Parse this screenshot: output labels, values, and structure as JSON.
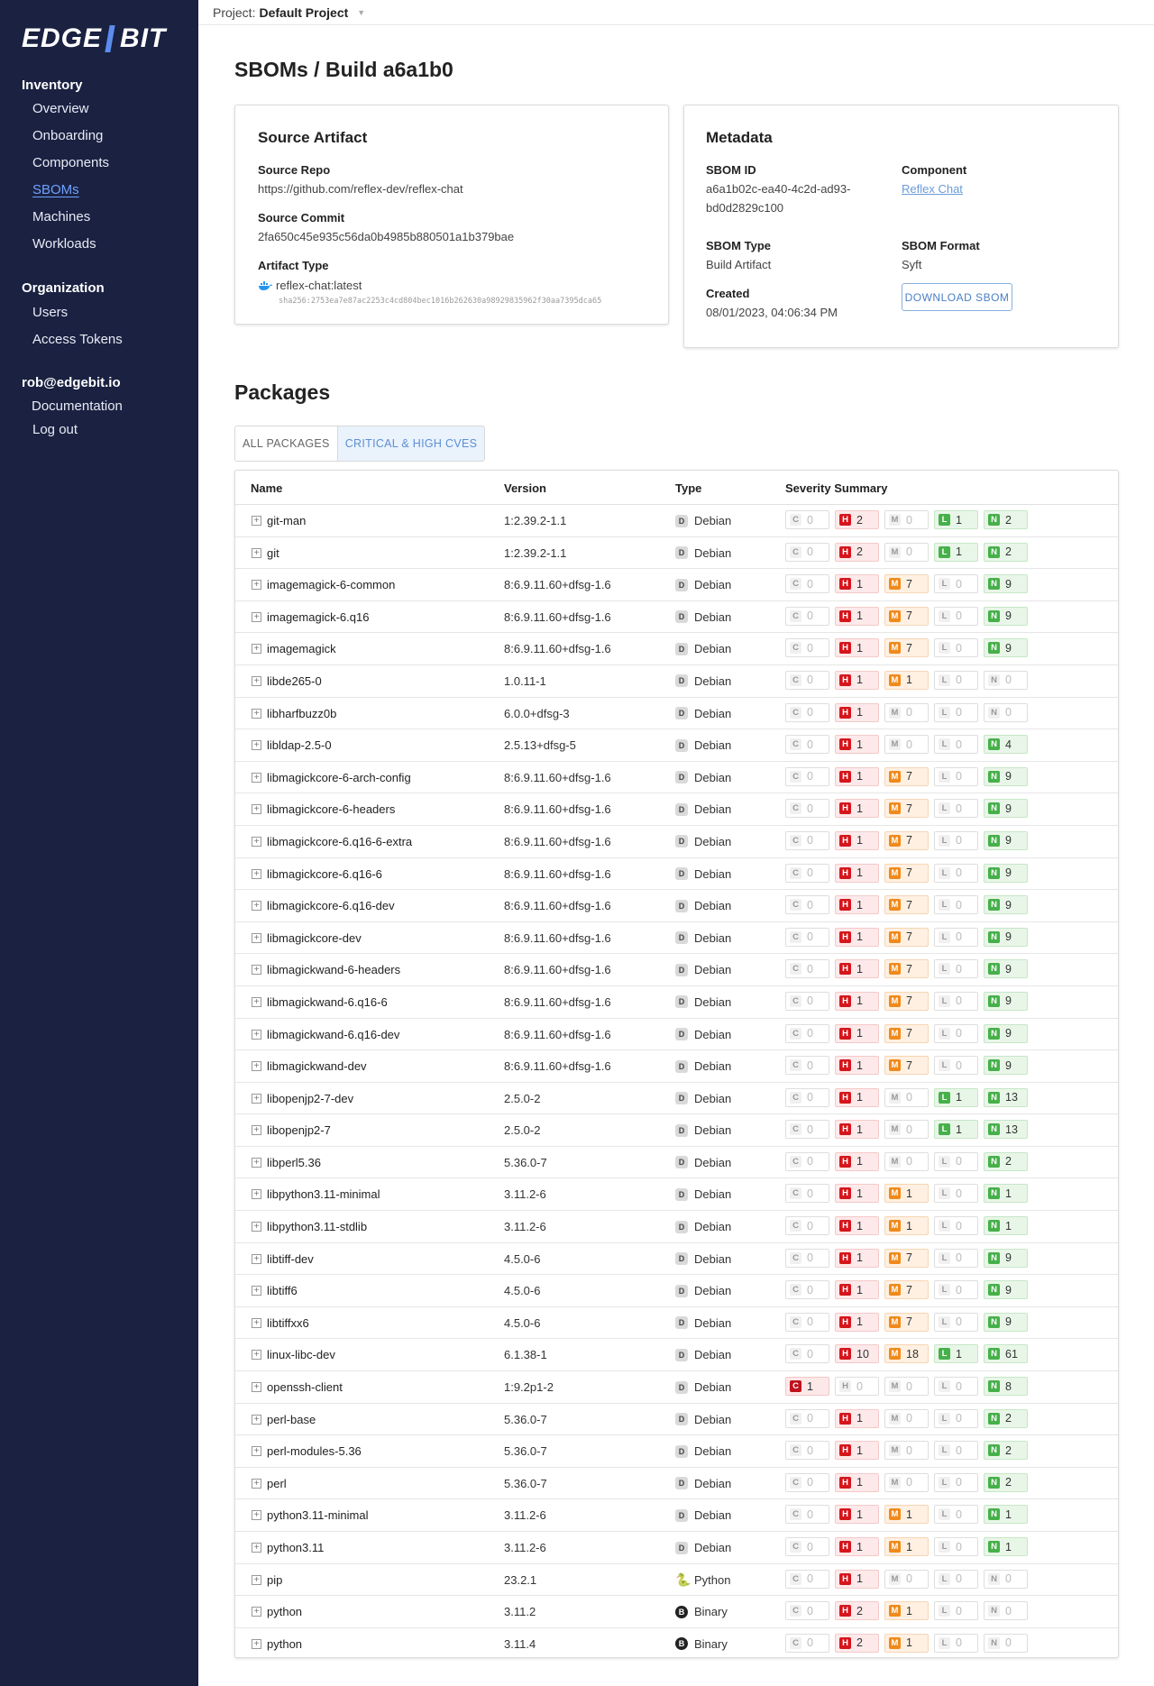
{
  "sidebar": {
    "logo_left": "EDGE",
    "logo_right": "BIT",
    "inventory_heading": "Inventory",
    "inventory_items": [
      "Overview",
      "Onboarding",
      "Components",
      "SBOMs",
      "Machines",
      "Workloads"
    ],
    "active_item": "SBOMs",
    "organization_heading": "Organization",
    "organization_items": [
      "Users",
      "Access Tokens"
    ],
    "user_email": "rob@edgebit.io",
    "user_items": [
      "Documentation",
      "Log out"
    ]
  },
  "topbar": {
    "project_label": "Project:",
    "project_value": "Default Project"
  },
  "page_title": "SBOMs / Build a6a1b0",
  "source_artifact": {
    "title": "Source Artifact",
    "repo_label": "Source Repo",
    "repo_value": "https://github.com/reflex-dev/reflex-chat",
    "commit_label": "Source Commit",
    "commit_value": "2fa650c45e935c56da0b4985b880501a1b379bae",
    "artifact_type_label": "Artifact Type",
    "artifact_image": "reflex-chat:latest",
    "artifact_digest": "sha256:2753ea7e87ac2253c4cd804bec1016b262630a98929835962f30aa7395dca65"
  },
  "metadata": {
    "title": "Metadata",
    "sbom_id_label": "SBOM ID",
    "sbom_id_line1": "a6a1b02c-ea40-4c2d-ad93-",
    "sbom_id_line2": "bd0d2829c100",
    "component_label": "Component",
    "component_value": "Reflex Chat",
    "sbom_type_label": "SBOM Type",
    "sbom_type_value": "Build Artifact",
    "sbom_format_label": "SBOM Format",
    "sbom_format_value": "Syft",
    "created_label": "Created",
    "created_value": "08/01/2023, 04:06:34 PM",
    "download_button": "DOWNLOAD SBOM"
  },
  "packages": {
    "title": "Packages",
    "tabs": [
      "ALL PACKAGES",
      "CRITICAL & HIGH CVES"
    ],
    "active_tab": "CRITICAL & HIGH CVES",
    "columns": [
      "Name",
      "Version",
      "Type",
      "Severity Summary"
    ],
    "severity_letters": [
      "C",
      "H",
      "M",
      "L",
      "N"
    ],
    "rows": [
      {
        "name": "git-man",
        "version": "1:2.39.2-1.1",
        "type": "Debian",
        "sev": [
          0,
          2,
          0,
          1,
          2
        ]
      },
      {
        "name": "git",
        "version": "1:2.39.2-1.1",
        "type": "Debian",
        "sev": [
          0,
          2,
          0,
          1,
          2
        ]
      },
      {
        "name": "imagemagick-6-common",
        "version": "8:6.9.11.60+dfsg-1.6",
        "type": "Debian",
        "sev": [
          0,
          1,
          7,
          0,
          9
        ]
      },
      {
        "name": "imagemagick-6.q16",
        "version": "8:6.9.11.60+dfsg-1.6",
        "type": "Debian",
        "sev": [
          0,
          1,
          7,
          0,
          9
        ]
      },
      {
        "name": "imagemagick",
        "version": "8:6.9.11.60+dfsg-1.6",
        "type": "Debian",
        "sev": [
          0,
          1,
          7,
          0,
          9
        ]
      },
      {
        "name": "libde265-0",
        "version": "1.0.11-1",
        "type": "Debian",
        "sev": [
          0,
          1,
          1,
          0,
          0
        ]
      },
      {
        "name": "libharfbuzz0b",
        "version": "6.0.0+dfsg-3",
        "type": "Debian",
        "sev": [
          0,
          1,
          0,
          0,
          0
        ]
      },
      {
        "name": "libldap-2.5-0",
        "version": "2.5.13+dfsg-5",
        "type": "Debian",
        "sev": [
          0,
          1,
          0,
          0,
          4
        ]
      },
      {
        "name": "libmagickcore-6-arch-config",
        "version": "8:6.9.11.60+dfsg-1.6",
        "type": "Debian",
        "sev": [
          0,
          1,
          7,
          0,
          9
        ]
      },
      {
        "name": "libmagickcore-6-headers",
        "version": "8:6.9.11.60+dfsg-1.6",
        "type": "Debian",
        "sev": [
          0,
          1,
          7,
          0,
          9
        ]
      },
      {
        "name": "libmagickcore-6.q16-6-extra",
        "version": "8:6.9.11.60+dfsg-1.6",
        "type": "Debian",
        "sev": [
          0,
          1,
          7,
          0,
          9
        ]
      },
      {
        "name": "libmagickcore-6.q16-6",
        "version": "8:6.9.11.60+dfsg-1.6",
        "type": "Debian",
        "sev": [
          0,
          1,
          7,
          0,
          9
        ]
      },
      {
        "name": "libmagickcore-6.q16-dev",
        "version": "8:6.9.11.60+dfsg-1.6",
        "type": "Debian",
        "sev": [
          0,
          1,
          7,
          0,
          9
        ]
      },
      {
        "name": "libmagickcore-dev",
        "version": "8:6.9.11.60+dfsg-1.6",
        "type": "Debian",
        "sev": [
          0,
          1,
          7,
          0,
          9
        ]
      },
      {
        "name": "libmagickwand-6-headers",
        "version": "8:6.9.11.60+dfsg-1.6",
        "type": "Debian",
        "sev": [
          0,
          1,
          7,
          0,
          9
        ]
      },
      {
        "name": "libmagickwand-6.q16-6",
        "version": "8:6.9.11.60+dfsg-1.6",
        "type": "Debian",
        "sev": [
          0,
          1,
          7,
          0,
          9
        ]
      },
      {
        "name": "libmagickwand-6.q16-dev",
        "version": "8:6.9.11.60+dfsg-1.6",
        "type": "Debian",
        "sev": [
          0,
          1,
          7,
          0,
          9
        ]
      },
      {
        "name": "libmagickwand-dev",
        "version": "8:6.9.11.60+dfsg-1.6",
        "type": "Debian",
        "sev": [
          0,
          1,
          7,
          0,
          9
        ]
      },
      {
        "name": "libopenjp2-7-dev",
        "version": "2.5.0-2",
        "type": "Debian",
        "sev": [
          0,
          1,
          0,
          1,
          13
        ]
      },
      {
        "name": "libopenjp2-7",
        "version": "2.5.0-2",
        "type": "Debian",
        "sev": [
          0,
          1,
          0,
          1,
          13
        ]
      },
      {
        "name": "libperl5.36",
        "version": "5.36.0-7",
        "type": "Debian",
        "sev": [
          0,
          1,
          0,
          0,
          2
        ]
      },
      {
        "name": "libpython3.11-minimal",
        "version": "3.11.2-6",
        "type": "Debian",
        "sev": [
          0,
          1,
          1,
          0,
          1
        ]
      },
      {
        "name": "libpython3.11-stdlib",
        "version": "3.11.2-6",
        "type": "Debian",
        "sev": [
          0,
          1,
          1,
          0,
          1
        ]
      },
      {
        "name": "libtiff-dev",
        "version": "4.5.0-6",
        "type": "Debian",
        "sev": [
          0,
          1,
          7,
          0,
          9
        ]
      },
      {
        "name": "libtiff6",
        "version": "4.5.0-6",
        "type": "Debian",
        "sev": [
          0,
          1,
          7,
          0,
          9
        ]
      },
      {
        "name": "libtiffxx6",
        "version": "4.5.0-6",
        "type": "Debian",
        "sev": [
          0,
          1,
          7,
          0,
          9
        ]
      },
      {
        "name": "linux-libc-dev",
        "version": "6.1.38-1",
        "type": "Debian",
        "sev": [
          0,
          10,
          18,
          1,
          61
        ]
      },
      {
        "name": "openssh-client",
        "version": "1:9.2p1-2",
        "type": "Debian",
        "sev": [
          1,
          0,
          0,
          0,
          8
        ]
      },
      {
        "name": "perl-base",
        "version": "5.36.0-7",
        "type": "Debian",
        "sev": [
          0,
          1,
          0,
          0,
          2
        ]
      },
      {
        "name": "perl-modules-5.36",
        "version": "5.36.0-7",
        "type": "Debian",
        "sev": [
          0,
          1,
          0,
          0,
          2
        ]
      },
      {
        "name": "perl",
        "version": "5.36.0-7",
        "type": "Debian",
        "sev": [
          0,
          1,
          0,
          0,
          2
        ]
      },
      {
        "name": "python3.11-minimal",
        "version": "3.11.2-6",
        "type": "Debian",
        "sev": [
          0,
          1,
          1,
          0,
          1
        ]
      },
      {
        "name": "python3.11",
        "version": "3.11.2-6",
        "type": "Debian",
        "sev": [
          0,
          1,
          1,
          0,
          1
        ]
      },
      {
        "name": "pip",
        "version": "23.2.1",
        "type": "Python",
        "sev": [
          0,
          1,
          0,
          0,
          0
        ]
      },
      {
        "name": "python",
        "version": "3.11.2",
        "type": "Binary",
        "sev": [
          0,
          2,
          1,
          0,
          0
        ]
      },
      {
        "name": "python",
        "version": "3.11.4",
        "type": "Binary",
        "sev": [
          0,
          2,
          1,
          0,
          0
        ]
      }
    ]
  },
  "icons": {
    "expand": "plus-box-icon",
    "debian": "debian-badge-icon",
    "python": "python-logo-icon",
    "binary": "binary-badge-icon",
    "docker": "docker-whale-icon",
    "caret": "chevron-down-icon"
  },
  "colors": {
    "sidebar_bg": "#1a2141",
    "accent": "#6fa3ff",
    "critical": "#c0121e",
    "high": "#d6151c",
    "medium": "#f08a1a",
    "low": "#46b04a",
    "negligible": "#46b04a"
  }
}
